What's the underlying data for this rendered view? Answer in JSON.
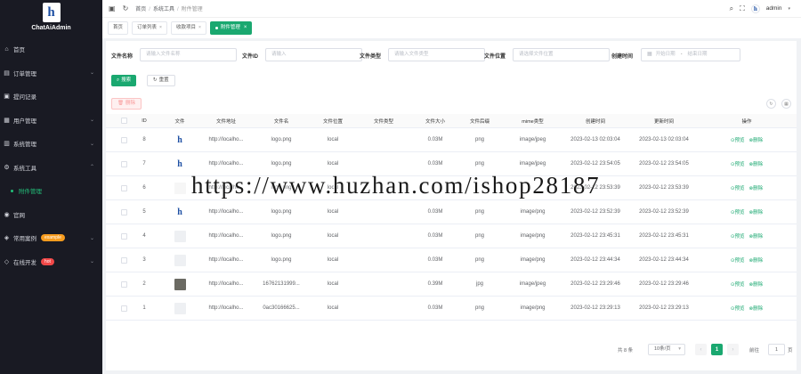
{
  "app": {
    "title": "ChatAiAdmin",
    "logo_letter": "h"
  },
  "sidebar": {
    "items": [
      {
        "label": "首页",
        "icon": "home-icon",
        "glyph": "⌂",
        "arrow": ""
      },
      {
        "label": "订单管理",
        "icon": "cart-icon",
        "glyph": "▤",
        "arrow": "⌄"
      },
      {
        "label": "提问记录",
        "icon": "chat-icon",
        "glyph": "▣",
        "arrow": ""
      },
      {
        "label": "用户管理",
        "icon": "user-icon",
        "glyph": "▦",
        "arrow": "⌄"
      },
      {
        "label": "系统管理",
        "icon": "settings-icon",
        "glyph": "▥",
        "arrow": "⌄"
      },
      {
        "label": "系统工具",
        "icon": "tool-icon",
        "glyph": "⚙",
        "arrow": "⌃"
      },
      {
        "label": "附件管理",
        "icon": "",
        "glyph": "",
        "arrow": ""
      },
      {
        "label": "官网",
        "icon": "globe-icon",
        "glyph": "◉",
        "arrow": ""
      },
      {
        "label": "常用案例",
        "icon": "case-icon",
        "glyph": "◈",
        "arrow": "⌄",
        "badge": "example"
      },
      {
        "label": "在线开发",
        "icon": "code-icon",
        "glyph": "◇",
        "arrow": "⌄",
        "badge": "hot"
      }
    ]
  },
  "header": {
    "breadcrumb": [
      "首页",
      "系统工具",
      "附件管理"
    ],
    "user": "admin",
    "avatar_letter": "h"
  },
  "tabs": [
    {
      "label": "首页",
      "chev": ""
    },
    {
      "label": "订单列表",
      "chev": "×"
    },
    {
      "label": "收款项目",
      "chev": "×"
    },
    {
      "label": "附件管理",
      "chev": "×",
      "active": true
    }
  ],
  "filters": {
    "file_name_label": "文件名称",
    "file_name_placeholder": "请输入文件名称",
    "file_id_label": "文件ID",
    "file_id_placeholder": "请输入",
    "file_type_label": "文件类型",
    "file_type_placeholder": "请输入文件类型",
    "file_location_label": "文件位置",
    "file_location_placeholder": "请选择文件位置",
    "created_label": "创建时间",
    "start_date_placeholder": "开始日期",
    "end_date_placeholder": "结束日期",
    "range_sep": "-",
    "search_button": "搜索",
    "reset_button": "重置",
    "delete_button": "删除"
  },
  "table": {
    "columns": [
      "ID",
      "文件",
      "文件地址",
      "文件名",
      "文件位置",
      "文件类型",
      "文件大小",
      "文件后缀",
      "mime类型",
      "创建时间",
      "更新时间",
      "操作"
    ],
    "rows": [
      {
        "id": "8",
        "thumb": "logo",
        "url": "http://localho...",
        "name": "logo.png",
        "location": "local",
        "type": "",
        "size": "0.03M",
        "ext": "png",
        "mime": "image/jpeg",
        "created": "2023-02-13 02:03:04",
        "updated": "2023-02-13 02:03:04"
      },
      {
        "id": "7",
        "thumb": "logo",
        "url": "http://localho...",
        "name": "logo.png",
        "location": "local",
        "type": "",
        "size": "0.03M",
        "ext": "png",
        "mime": "image/jpeg",
        "created": "2023-02-12 23:54:05",
        "updated": "2023-02-12 23:54:05"
      },
      {
        "id": "6",
        "thumb": "text",
        "url": "http://localho...",
        "name": "logo.png",
        "location": "local",
        "type": "",
        "size": "",
        "ext": "",
        "mime": "",
        "created": "2023-02-12 23:53:39",
        "updated": "2023-02-12 23:53:39"
      },
      {
        "id": "5",
        "thumb": "logo",
        "url": "http://localho...",
        "name": "logo.png",
        "location": "local",
        "type": "",
        "size": "0.03M",
        "ext": "png",
        "mime": "image/png",
        "created": "2023-02-12 23:52:39",
        "updated": "2023-02-12 23:52:39"
      },
      {
        "id": "4",
        "thumb": "grey",
        "url": "http://localho...",
        "name": "logo.png",
        "location": "local",
        "type": "",
        "size": "0.03M",
        "ext": "png",
        "mime": "image/png",
        "created": "2023-02-12 23:45:31",
        "updated": "2023-02-12 23:45:31"
      },
      {
        "id": "3",
        "thumb": "grey",
        "url": "http://localho...",
        "name": "logo.png",
        "location": "local",
        "type": "",
        "size": "0.03M",
        "ext": "png",
        "mime": "image/png",
        "created": "2023-02-12 23:44:34",
        "updated": "2023-02-12 23:44:34"
      },
      {
        "id": "2",
        "thumb": "photo",
        "url": "http://localho...",
        "name": "16762131999...",
        "location": "local",
        "type": "",
        "size": "0.39M",
        "ext": "jpg",
        "mime": "image/jpeg",
        "created": "2023-02-12 23:29:46",
        "updated": "2023-02-12 23:29:46"
      },
      {
        "id": "1",
        "thumb": "grey",
        "url": "http://localho...",
        "name": "0ac30166625...",
        "location": "local",
        "type": "",
        "size": "0.03M",
        "ext": "png",
        "mime": "image/png",
        "created": "2023-02-12 23:29:13",
        "updated": "2023-02-12 23:29:13"
      }
    ],
    "preview_action": "预览",
    "delete_action": "删除"
  },
  "pagination": {
    "total": "共 8 条",
    "page_size": "10条/页",
    "current_page": "1",
    "goto_label": "前往",
    "goto_value": "1",
    "goto_suffix": "页"
  },
  "watermark": "https://www.huzhan.com/ishop28187",
  "colors": {
    "sidebar_bg": "#191a23",
    "accent": "#1aa870",
    "danger": "#f04848"
  }
}
